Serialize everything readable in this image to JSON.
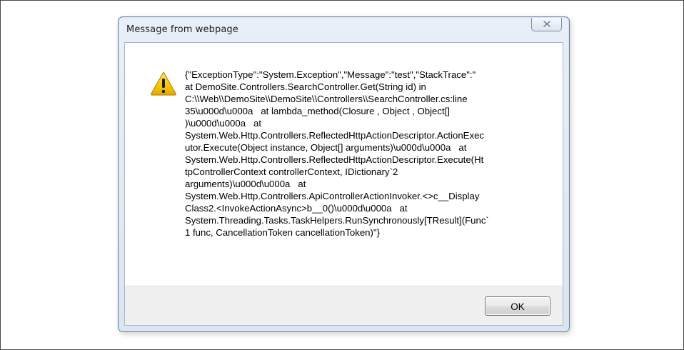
{
  "dialog": {
    "title": "Message from webpage",
    "close_icon": "close-icon",
    "warning_icon": "warning-icon",
    "message_lines": [
      "{\"ExceptionType\":\"System.Exception\",\"Message\":\"test\",\"StackTrace\":\"",
      "at DemoSite.Controllers.SearchController.Get(String id) in",
      "C:\\\\Web\\\\DemoSite\\\\DemoSite\\\\Controllers\\\\SearchController.cs:line",
      "35\\u000d\\u000a   at lambda_method(Closure , Object , Object[]",
      ")\\u000d\\u000a   at",
      "System.Web.Http.Controllers.ReflectedHttpActionDescriptor.ActionExec",
      "utor.Execute(Object instance, Object[] arguments)\\u000d\\u000a   at",
      "System.Web.Http.Controllers.ReflectedHttpActionDescriptor.Execute(Ht",
      "tpControllerContext controllerContext, IDictionary`2",
      "arguments)\\u000d\\u000a   at",
      "System.Web.Http.Controllers.ApiControllerActionInvoker.<>c__Display",
      "Class2.<InvokeActionAsync>b__0()\\u000d\\u000a   at",
      "System.Threading.Tasks.TaskHelpers.RunSynchronously[TResult](Func`",
      "1 func, CancellationToken cancellationToken)\"}"
    ],
    "ok_label": "OK"
  },
  "colors": {
    "frame_border": "#6f7f96",
    "titlebar_tint": "#dbe6f3",
    "content_background": "#ffffff",
    "footer_background": "#f0f0f0",
    "warning_yellow": "#f6c700"
  }
}
